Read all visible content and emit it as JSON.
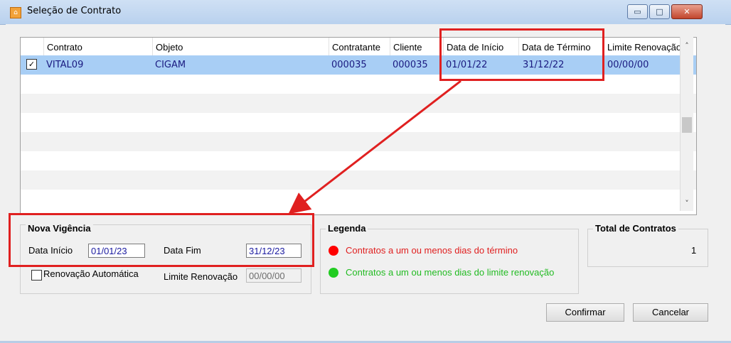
{
  "window": {
    "title": "Seleção de Contrato",
    "minimize": "▭",
    "maximize": "□",
    "close": "✕"
  },
  "grid": {
    "columns": [
      "Contrato",
      "Objeto",
      "Contratante",
      "Cliente",
      "Data de Início",
      "Data de Término",
      "Limite Renovação"
    ],
    "rows": [
      {
        "checked": true,
        "contrato": "VITAL09",
        "objeto": "CIGAM",
        "contratante": "000035",
        "cliente": "000035",
        "inicio": "01/01/22",
        "termino": "31/12/22",
        "limite": "00/00/00"
      }
    ]
  },
  "nova_vigencia": {
    "title": "Nova Vigência",
    "data_inicio_label": "Data Início",
    "data_inicio_value": "01/01/23",
    "data_fim_label": "Data Fim",
    "data_fim_value": "31/12/23",
    "renovacao_label": "Renovação Automática",
    "limite_label": "Limite Renovação",
    "limite_value": "00/00/00"
  },
  "legenda": {
    "title": "Legenda",
    "items": [
      {
        "text": "Contratos a um ou menos dias do término",
        "color": "#ff0000"
      },
      {
        "text": "Contratos a um ou menos dias do limite renovação",
        "color": "#22cc22"
      }
    ]
  },
  "total": {
    "title": "Total de Contratos",
    "value": "1"
  },
  "buttons": {
    "confirmar": "Confirmar",
    "cancelar": "Cancelar"
  },
  "colors": {
    "highlight": "#e02020",
    "selected_row": "#a8cef5"
  }
}
